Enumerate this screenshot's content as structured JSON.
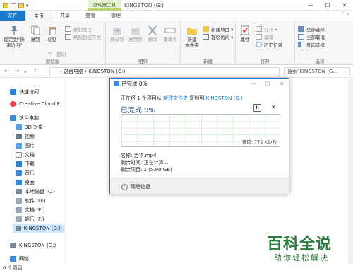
{
  "window": {
    "title": "KINGSTON (G:)",
    "tools_tab": "驱动器工具",
    "min": "—",
    "max": "☐",
    "close": "✕"
  },
  "tabs": [
    {
      "label": "文件"
    },
    {
      "label": "主页"
    },
    {
      "label": "共享"
    },
    {
      "label": "查看"
    },
    {
      "label": "管理"
    }
  ],
  "ribbon": {
    "clipboard": {
      "pin": "固定到\"快\n速访问\"",
      "copy": "复制",
      "paste": "粘贴",
      "copy_path": "复制路径",
      "paste_shortcut": "粘贴快捷方式",
      "cut": "剪切",
      "label": "剪贴板"
    },
    "organize": {
      "move_to": "移动到",
      "copy_to": "复制到",
      "delete": "删除",
      "rename": "重命名",
      "label": "组织"
    },
    "new": {
      "new_folder": "新建\n文件夹",
      "new_item": "新建项目 ▾",
      "easy_access": "轻松访问 ▾",
      "label": "新建"
    },
    "open": {
      "properties": "属性",
      "open": "打开 ▾",
      "edit": "编辑",
      "history": "历史记录",
      "label": "打开"
    },
    "select": {
      "select_all": "全部选择",
      "select_none": "全部取消",
      "invert": "反向选择",
      "label": "选择"
    }
  },
  "address": {
    "path": "› 这台电脑 › KINGSTON (G:)",
    "search_placeholder": "搜索\"KINGSTON (G..."
  },
  "sidebar": {
    "items": [
      {
        "label": "快速访问"
      },
      {
        "label": "Creative Cloud F"
      },
      {
        "label": "这台电脑"
      },
      {
        "label": "3D 对象"
      },
      {
        "label": "视频"
      },
      {
        "label": "图片"
      },
      {
        "label": "文档"
      },
      {
        "label": "下载"
      },
      {
        "label": "音乐"
      },
      {
        "label": "桌面"
      },
      {
        "label": "本地磁盘 (C:)"
      },
      {
        "label": "软件 (D:)"
      },
      {
        "label": "文档 (E:)"
      },
      {
        "label": "娱乐 (F:)"
      },
      {
        "label": "KINGSTON (G:)"
      },
      {
        "label": "KINGSTON (G:)"
      },
      {
        "label": "网络"
      }
    ]
  },
  "status": {
    "count": "0 个项目"
  },
  "dialog": {
    "title": "已完成 0%",
    "line_prefix": "正在将 1 个项目从",
    "source": "新建文件夹",
    "line_mid": "复制到",
    "dest": "KINGSTON (G:)",
    "progress_title": "已完成 0%",
    "pause": "II",
    "cancel": "✕",
    "speed": "速度: 772 KB/秒",
    "name": "名称: 芳华.mp4",
    "time": "剩余时间: 正在计算...",
    "items": "剩余项目: 1 (5.90 GB)",
    "less_info": "简略信息",
    "progress": 0
  },
  "watermark": {
    "brand": "百科全说",
    "slogan": "助你轻松解决"
  }
}
